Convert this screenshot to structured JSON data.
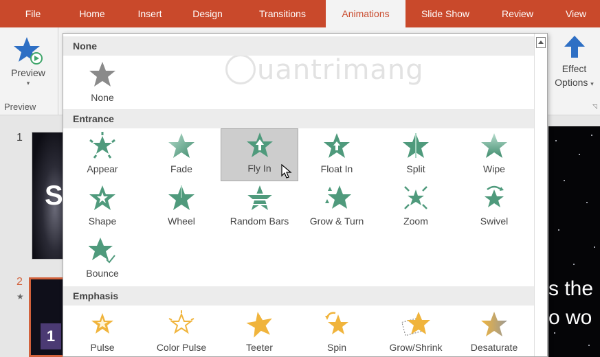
{
  "tabs": [
    {
      "label": "File",
      "active": false
    },
    {
      "label": "Home",
      "active": false
    },
    {
      "label": "Insert",
      "active": false
    },
    {
      "label": "Design",
      "active": false
    },
    {
      "label": "Transitions",
      "active": false
    },
    {
      "label": "Animations",
      "active": true
    },
    {
      "label": "Slide Show",
      "active": false
    },
    {
      "label": "Review",
      "active": false
    },
    {
      "label": "View",
      "active": false
    }
  ],
  "ribbon": {
    "preview_label": "Preview",
    "preview_group_label": "Preview",
    "effect_options_line1": "Effect",
    "effect_options_line2": "Options",
    "effect_options_caret": "▾"
  },
  "thumbnails": [
    {
      "number": "1",
      "text": "S"
    },
    {
      "number": "2",
      "text": "1",
      "animation_marker": "★"
    }
  ],
  "slide_canvas": {
    "line1": "s the",
    "line2": "o wo"
  },
  "watermark": "uantrimang",
  "gallery": {
    "sections": [
      {
        "heading": "None",
        "effects": [
          {
            "label": "None",
            "icon": "star-none-icon"
          }
        ]
      },
      {
        "heading": "Entrance",
        "effects": [
          {
            "label": "Appear",
            "icon": "appear-star-icon"
          },
          {
            "label": "Fade",
            "icon": "fade-star-icon"
          },
          {
            "label": "Fly In",
            "icon": "fly-in-star-icon",
            "selected": true
          },
          {
            "label": "Float In",
            "icon": "float-in-star-icon"
          },
          {
            "label": "Split",
            "icon": "split-star-icon"
          },
          {
            "label": "Wipe",
            "icon": "wipe-star-icon"
          },
          {
            "label": "Shape",
            "icon": "shape-star-icon"
          },
          {
            "label": "Wheel",
            "icon": "wheel-star-icon"
          },
          {
            "label": "Random Bars",
            "icon": "random-bars-star-icon"
          },
          {
            "label": "Grow & Turn",
            "icon": "grow-turn-star-icon"
          },
          {
            "label": "Zoom",
            "icon": "zoom-star-icon"
          },
          {
            "label": "Swivel",
            "icon": "swivel-star-icon"
          },
          {
            "label": "Bounce",
            "icon": "bounce-star-icon"
          }
        ]
      },
      {
        "heading": "Emphasis",
        "effects": [
          {
            "label": "Pulse",
            "icon": "pulse-star-icon"
          },
          {
            "label": "Color Pulse",
            "icon": "color-pulse-star-icon"
          },
          {
            "label": "Teeter",
            "icon": "teeter-star-icon"
          },
          {
            "label": "Spin",
            "icon": "spin-star-icon"
          },
          {
            "label": "Grow/Shrink",
            "icon": "grow-shrink-star-icon"
          },
          {
            "label": "Desaturate",
            "icon": "desaturate-star-icon"
          }
        ]
      }
    ]
  },
  "colors": {
    "tab_bar": "#c9492b",
    "entrance_star": "#4f9a7c",
    "emphasis_star": "#f0b43c",
    "none_star": "#8a8a8a",
    "selected_bg": "#cdcdcd",
    "preview_star": "#2e6fc4"
  }
}
